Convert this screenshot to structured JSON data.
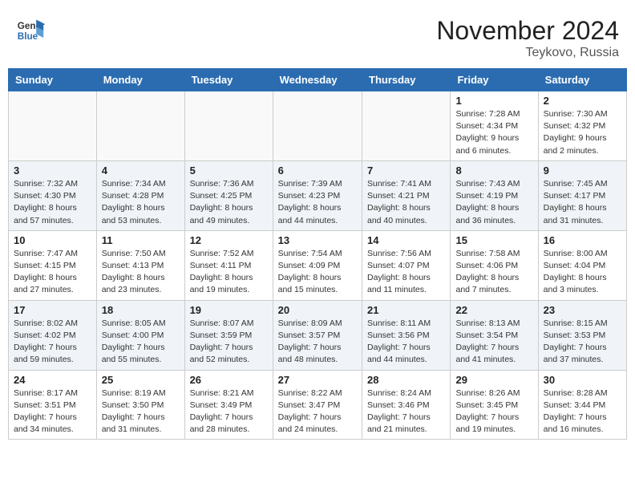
{
  "logo": {
    "line1": "General",
    "line2": "Blue"
  },
  "title": "November 2024",
  "location": "Teykovo, Russia",
  "days_of_week": [
    "Sunday",
    "Monday",
    "Tuesday",
    "Wednesday",
    "Thursday",
    "Friday",
    "Saturday"
  ],
  "weeks": [
    [
      {
        "day": "",
        "info": ""
      },
      {
        "day": "",
        "info": ""
      },
      {
        "day": "",
        "info": ""
      },
      {
        "day": "",
        "info": ""
      },
      {
        "day": "",
        "info": ""
      },
      {
        "day": "1",
        "info": "Sunrise: 7:28 AM\nSunset: 4:34 PM\nDaylight: 9 hours\nand 6 minutes."
      },
      {
        "day": "2",
        "info": "Sunrise: 7:30 AM\nSunset: 4:32 PM\nDaylight: 9 hours\nand 2 minutes."
      }
    ],
    [
      {
        "day": "3",
        "info": "Sunrise: 7:32 AM\nSunset: 4:30 PM\nDaylight: 8 hours\nand 57 minutes."
      },
      {
        "day": "4",
        "info": "Sunrise: 7:34 AM\nSunset: 4:28 PM\nDaylight: 8 hours\nand 53 minutes."
      },
      {
        "day": "5",
        "info": "Sunrise: 7:36 AM\nSunset: 4:25 PM\nDaylight: 8 hours\nand 49 minutes."
      },
      {
        "day": "6",
        "info": "Sunrise: 7:39 AM\nSunset: 4:23 PM\nDaylight: 8 hours\nand 44 minutes."
      },
      {
        "day": "7",
        "info": "Sunrise: 7:41 AM\nSunset: 4:21 PM\nDaylight: 8 hours\nand 40 minutes."
      },
      {
        "day": "8",
        "info": "Sunrise: 7:43 AM\nSunset: 4:19 PM\nDaylight: 8 hours\nand 36 minutes."
      },
      {
        "day": "9",
        "info": "Sunrise: 7:45 AM\nSunset: 4:17 PM\nDaylight: 8 hours\nand 31 minutes."
      }
    ],
    [
      {
        "day": "10",
        "info": "Sunrise: 7:47 AM\nSunset: 4:15 PM\nDaylight: 8 hours\nand 27 minutes."
      },
      {
        "day": "11",
        "info": "Sunrise: 7:50 AM\nSunset: 4:13 PM\nDaylight: 8 hours\nand 23 minutes."
      },
      {
        "day": "12",
        "info": "Sunrise: 7:52 AM\nSunset: 4:11 PM\nDaylight: 8 hours\nand 19 minutes."
      },
      {
        "day": "13",
        "info": "Sunrise: 7:54 AM\nSunset: 4:09 PM\nDaylight: 8 hours\nand 15 minutes."
      },
      {
        "day": "14",
        "info": "Sunrise: 7:56 AM\nSunset: 4:07 PM\nDaylight: 8 hours\nand 11 minutes."
      },
      {
        "day": "15",
        "info": "Sunrise: 7:58 AM\nSunset: 4:06 PM\nDaylight: 8 hours\nand 7 minutes."
      },
      {
        "day": "16",
        "info": "Sunrise: 8:00 AM\nSunset: 4:04 PM\nDaylight: 8 hours\nand 3 minutes."
      }
    ],
    [
      {
        "day": "17",
        "info": "Sunrise: 8:02 AM\nSunset: 4:02 PM\nDaylight: 7 hours\nand 59 minutes."
      },
      {
        "day": "18",
        "info": "Sunrise: 8:05 AM\nSunset: 4:00 PM\nDaylight: 7 hours\nand 55 minutes."
      },
      {
        "day": "19",
        "info": "Sunrise: 8:07 AM\nSunset: 3:59 PM\nDaylight: 7 hours\nand 52 minutes."
      },
      {
        "day": "20",
        "info": "Sunrise: 8:09 AM\nSunset: 3:57 PM\nDaylight: 7 hours\nand 48 minutes."
      },
      {
        "day": "21",
        "info": "Sunrise: 8:11 AM\nSunset: 3:56 PM\nDaylight: 7 hours\nand 44 minutes."
      },
      {
        "day": "22",
        "info": "Sunrise: 8:13 AM\nSunset: 3:54 PM\nDaylight: 7 hours\nand 41 minutes."
      },
      {
        "day": "23",
        "info": "Sunrise: 8:15 AM\nSunset: 3:53 PM\nDaylight: 7 hours\nand 37 minutes."
      }
    ],
    [
      {
        "day": "24",
        "info": "Sunrise: 8:17 AM\nSunset: 3:51 PM\nDaylight: 7 hours\nand 34 minutes."
      },
      {
        "day": "25",
        "info": "Sunrise: 8:19 AM\nSunset: 3:50 PM\nDaylight: 7 hours\nand 31 minutes."
      },
      {
        "day": "26",
        "info": "Sunrise: 8:21 AM\nSunset: 3:49 PM\nDaylight: 7 hours\nand 28 minutes."
      },
      {
        "day": "27",
        "info": "Sunrise: 8:22 AM\nSunset: 3:47 PM\nDaylight: 7 hours\nand 24 minutes."
      },
      {
        "day": "28",
        "info": "Sunrise: 8:24 AM\nSunset: 3:46 PM\nDaylight: 7 hours\nand 21 minutes."
      },
      {
        "day": "29",
        "info": "Sunrise: 8:26 AM\nSunset: 3:45 PM\nDaylight: 7 hours\nand 19 minutes."
      },
      {
        "day": "30",
        "info": "Sunrise: 8:28 AM\nSunset: 3:44 PM\nDaylight: 7 hours\nand 16 minutes."
      }
    ]
  ]
}
